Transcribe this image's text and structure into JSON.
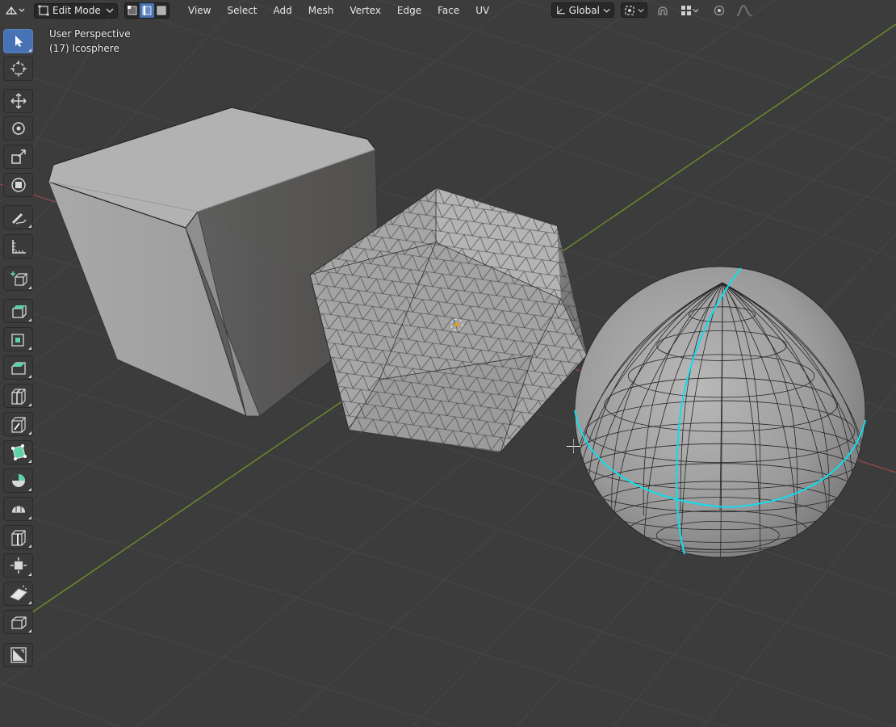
{
  "header": {
    "editor_type_icon": "mesh-editor-icon",
    "mode": "Edit Mode",
    "select_modes": [
      {
        "name": "vertex-select-mode",
        "active": false
      },
      {
        "name": "edge-select-mode",
        "active": true
      },
      {
        "name": "face-select-mode",
        "active": false
      }
    ],
    "menus": [
      "View",
      "Select",
      "Add",
      "Mesh",
      "Vertex",
      "Edge",
      "Face",
      "UV"
    ],
    "orientation": "Global",
    "pivot_icon": "pivot-point-icon",
    "snap_icon": "magnet-icon",
    "snap_mode_icon": "snap-increment-icon",
    "proportional_icon": "proportional-edit-icon",
    "falloff_icon": "falloff-curve-icon"
  },
  "viewport": {
    "view_name": "User Perspective",
    "object_info": "(17) Icosphere",
    "colors": {
      "background": "#3c3c3c",
      "grid": "#474747",
      "x_axis": "#9c4a4a",
      "y_axis": "#6b8f2a",
      "selected_edge": "#11ddee",
      "mesh_face": "#a8a8a8"
    }
  },
  "toolbar": {
    "tools": [
      {
        "name": "select-box-tool",
        "active": true
      },
      {
        "name": "cursor-tool",
        "active": false
      },
      {
        "name": "move-tool",
        "active": false
      },
      {
        "name": "rotate-tool",
        "active": false
      },
      {
        "name": "scale-tool",
        "active": false
      },
      {
        "name": "transform-tool",
        "active": false
      },
      {
        "name": "annotate-tool",
        "active": false
      },
      {
        "name": "measure-tool",
        "active": false
      },
      {
        "name": "add-cube-tool",
        "active": false
      },
      {
        "name": "extrude-region-tool",
        "active": false
      },
      {
        "name": "inset-faces-tool",
        "active": false
      },
      {
        "name": "bevel-tool",
        "active": false
      },
      {
        "name": "loop-cut-tool",
        "active": false
      },
      {
        "name": "knife-tool",
        "active": false
      },
      {
        "name": "poly-build-tool",
        "active": false
      },
      {
        "name": "spin-tool",
        "active": false
      },
      {
        "name": "smooth-tool",
        "active": false
      },
      {
        "name": "edge-slide-tool",
        "active": false
      },
      {
        "name": "shrink-fatten-tool",
        "active": false
      },
      {
        "name": "shear-tool",
        "active": false
      },
      {
        "name": "rip-region-tool",
        "active": false
      },
      {
        "name": "uv-project-tool",
        "active": false
      }
    ]
  }
}
